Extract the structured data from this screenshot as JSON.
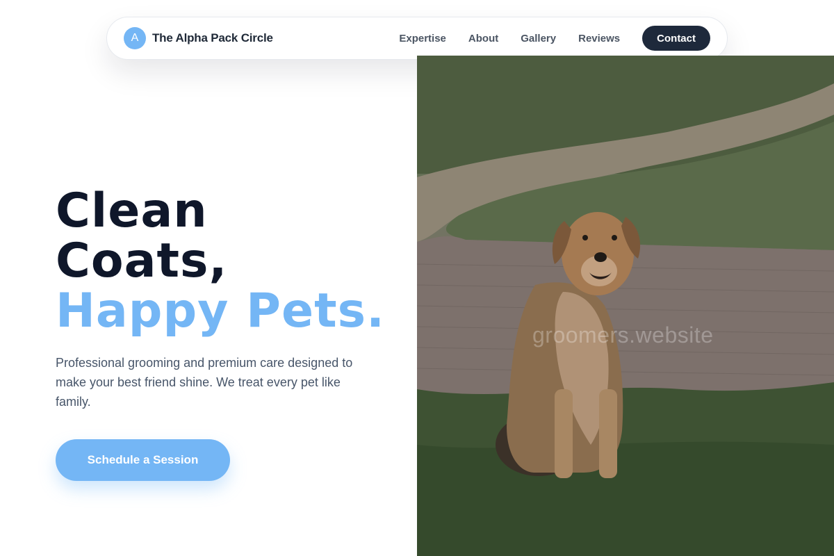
{
  "brand": {
    "initial": "A",
    "name": "The Alpha Pack Circle"
  },
  "nav": {
    "links": [
      "Expertise",
      "About",
      "Gallery",
      "Reviews"
    ],
    "contact_label": "Contact"
  },
  "hero": {
    "headline_line1": "Clean",
    "headline_line2": "Coats,",
    "headline_line3": "Happy Pets.",
    "subtext": "Professional grooming and premium care designed to make your best friend shine. We treat every pet like family.",
    "cta_label": "Schedule a Session",
    "image_watermark": "groomers.website"
  },
  "colors": {
    "accent": "#74b6f5",
    "dark": "#0f172a",
    "contact_button": "#1e293b"
  },
  "icons": {
    "brand_badge": "letter-badge-icon"
  }
}
